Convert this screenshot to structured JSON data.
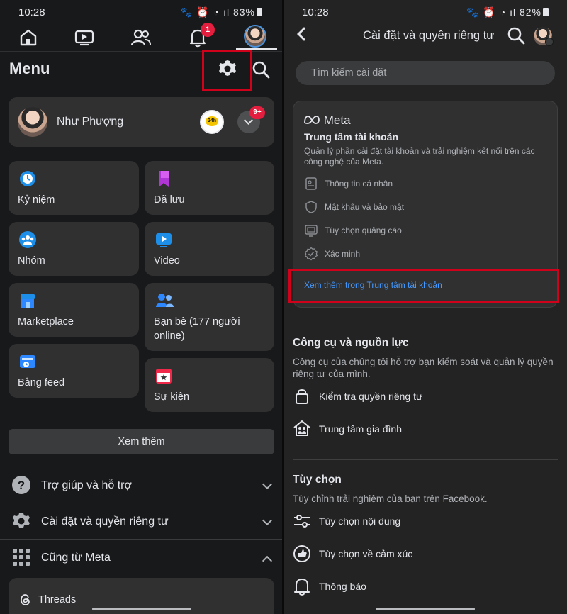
{
  "left": {
    "status": {
      "time": "10:28",
      "battery": "83%"
    },
    "nav": {
      "notification_badge": "1"
    },
    "menu_title": "Menu",
    "profile": {
      "name": "Như Phượng",
      "badge": "9+",
      "story_text": "24h"
    },
    "shortcuts_left": [
      {
        "label": "Kỷ niệm",
        "icon": "memories-clock-icon"
      },
      {
        "label": "Nhóm",
        "icon": "groups-icon"
      },
      {
        "label": "Marketplace",
        "icon": "marketplace-store-icon"
      },
      {
        "label": "Bảng feed",
        "icon": "feeds-icon"
      }
    ],
    "shortcuts_right": [
      {
        "label": "Đã lưu",
        "icon": "saved-bookmark-icon"
      },
      {
        "label": "Video",
        "icon": "video-play-icon"
      },
      {
        "label": "Bạn bè (177 người online)",
        "icon": "friends-icon"
      },
      {
        "label": "Sự kiện",
        "icon": "events-calendar-icon"
      }
    ],
    "see_more": "Xem thêm",
    "rows": [
      {
        "label": "Trợ giúp và hỗ trợ",
        "icon": "help-question-icon"
      },
      {
        "label": "Cài đặt và quyền riêng tư",
        "icon": "settings-gear-icon"
      },
      {
        "label": "Cũng từ Meta",
        "icon": "grid-apps-icon"
      }
    ],
    "threads_label": "Threads"
  },
  "right": {
    "status": {
      "time": "10:28",
      "battery": "82%"
    },
    "title": "Cài đặt và quyền riêng tư",
    "search_placeholder": "Tìm kiếm cài đặt",
    "meta_card": {
      "logo": "Meta",
      "title": "Trung tâm tài khoản",
      "description": "Quản lý phần cài đặt tài khoản và trải nghiệm kết nối trên các công nghệ của Meta.",
      "items": [
        "Thông tin cá nhân",
        "Mật khẩu và bảo mật",
        "Tùy chọn quảng cáo",
        "Xác minh"
      ],
      "link": "Xem thêm trong Trung tâm tài khoản"
    },
    "tools": {
      "title": "Công cụ và nguồn lực",
      "description": "Công cụ của chúng tôi hỗ trợ bạn kiểm soát và quản lý quyền riêng tư của mình.",
      "items": [
        "Kiểm tra quyền riêng tư",
        "Trung tâm gia đình"
      ]
    },
    "preferences": {
      "title": "Tùy chọn",
      "description": "Tùy chỉnh trải nghiệm của bạn trên Facebook.",
      "items": [
        "Tùy chọn nội dung",
        "Tùy chọn về cảm xúc",
        "Thông báo"
      ]
    }
  },
  "colors": {
    "highlight_box": "#d0021b",
    "link": "#4599ff",
    "badge": "#e41e3f"
  }
}
